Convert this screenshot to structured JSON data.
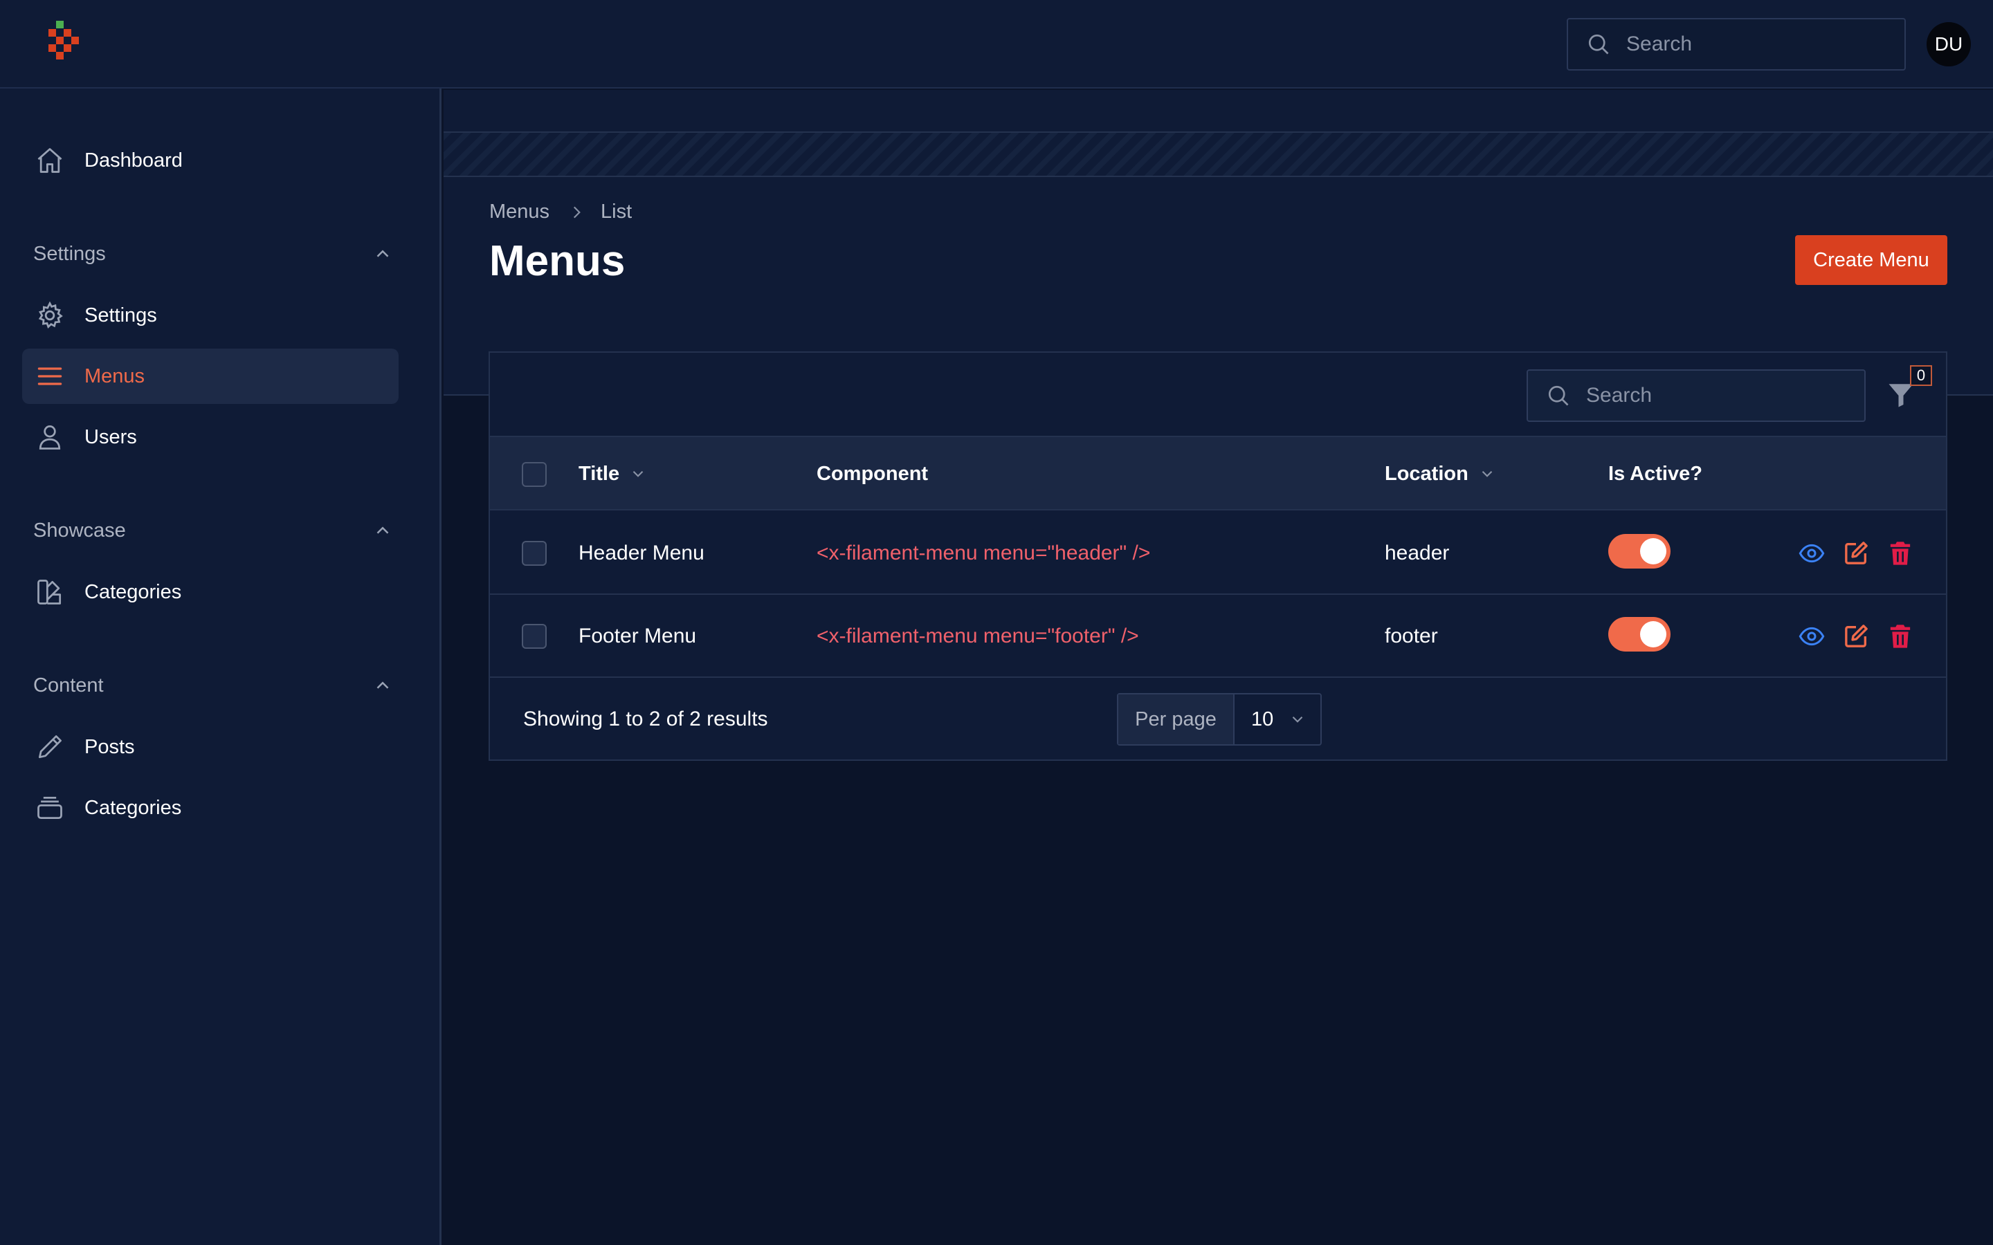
{
  "topbar": {
    "search_placeholder": "Search",
    "avatar_initials": "DU"
  },
  "sidebar": {
    "dashboard": "Dashboard",
    "groups": [
      {
        "label": "Settings",
        "items": [
          "Settings",
          "Menus",
          "Users"
        ]
      },
      {
        "label": "Showcase",
        "items": [
          "Categories"
        ]
      },
      {
        "label": "Content",
        "items": [
          "Posts",
          "Categories"
        ]
      }
    ],
    "active_item": "Menus"
  },
  "page": {
    "breadcrumb": [
      "Menus",
      "List"
    ],
    "title": "Menus",
    "create_button": "Create Menu"
  },
  "table": {
    "search_placeholder": "Search",
    "filter_count": "0",
    "columns": {
      "title": "Title",
      "component": "Component",
      "location": "Location",
      "active": "Is Active?"
    },
    "rows": [
      {
        "title": "Header Menu",
        "component": "<x-filament-menu menu=\"header\" />",
        "location": "header",
        "is_active": true
      },
      {
        "title": "Footer Menu",
        "component": "<x-filament-menu menu=\"footer\" />",
        "location": "footer",
        "is_active": true
      }
    ],
    "results_text": "Showing 1 to 2 of 2 results",
    "per_page_label": "Per page",
    "per_page_value": "10"
  },
  "colors": {
    "accent": "#d9401f",
    "active_nav": "#f06a4a",
    "component_text": "#f0616b",
    "view_icon": "#3b82f6"
  },
  "icons": {
    "logo": "brand-logo",
    "dashboard": "home-icon",
    "settings": "gear-icon",
    "menus": "bars-icon",
    "users": "user-icon",
    "showcase_categories": "swatch-icon",
    "posts": "pencil-icon",
    "content_categories": "stack-icon",
    "row_actions": [
      "eye-icon",
      "edit-icon",
      "trash-icon"
    ]
  }
}
